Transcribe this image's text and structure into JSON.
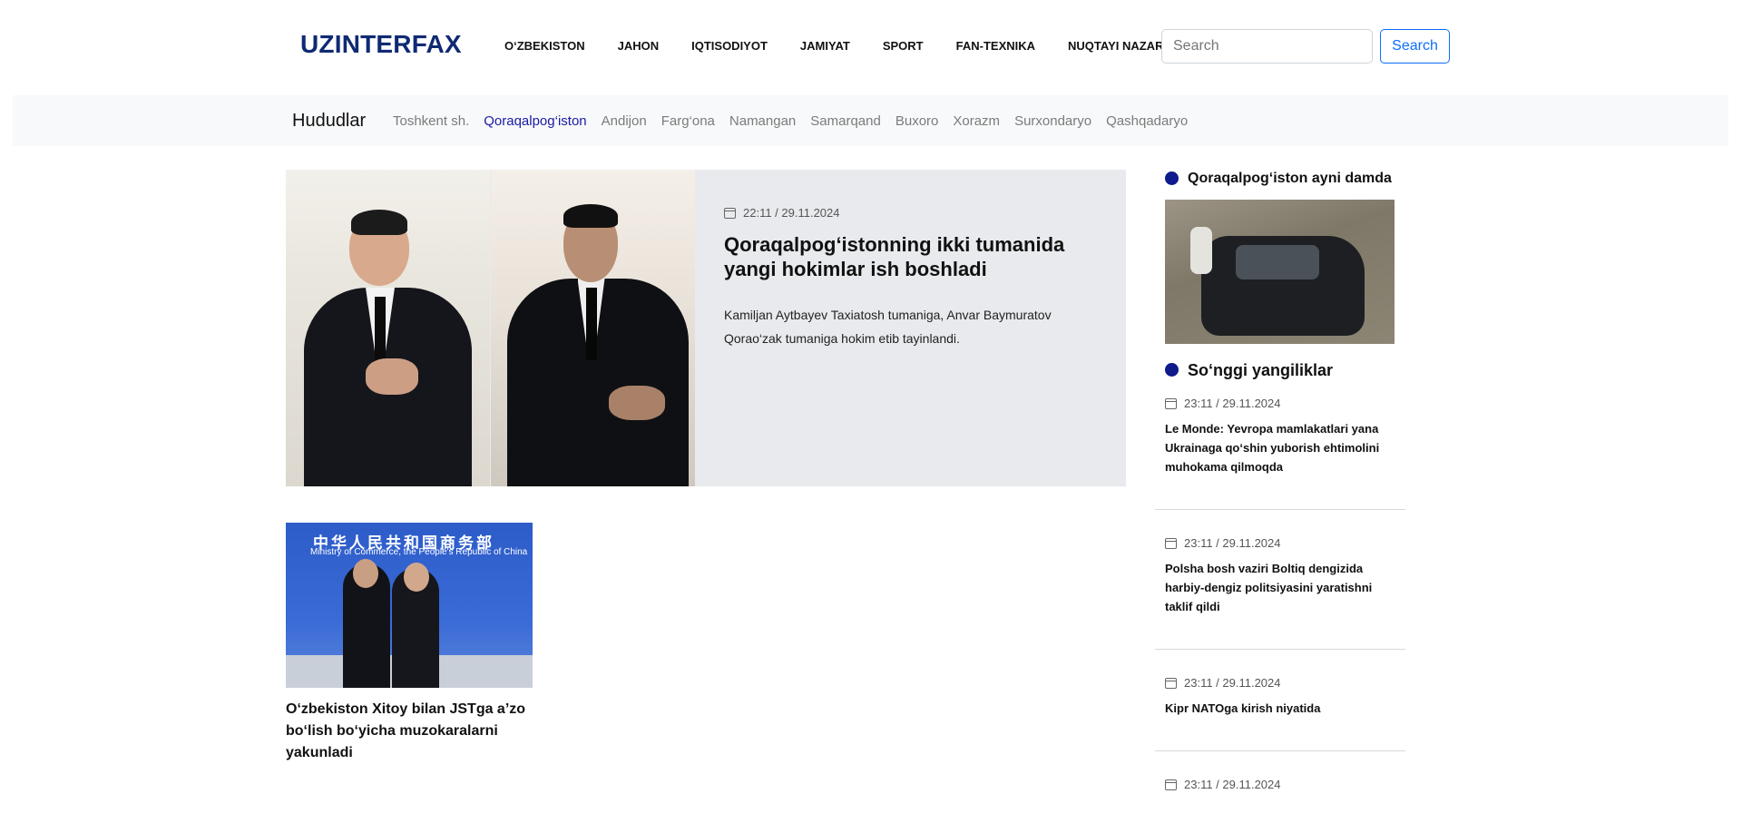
{
  "header": {
    "logo": "UZINTERFAX",
    "nav": [
      "O‘ZBEKISTON",
      "JAHON",
      "IQTISODIYOT",
      "JAMIYAT",
      "SPORT",
      "FAN-TEXNIKA",
      "NUQTAYI NAZAR"
    ],
    "search_placeholder": "Search",
    "search_button": "Search"
  },
  "regions": {
    "title": "Hududlar",
    "items": [
      "Toshkent sh.",
      "Qoraqalpog‘iston",
      "Andijon",
      "Farg‘ona",
      "Namangan",
      "Samarqand",
      "Buxoro",
      "Xorazm",
      "Surxondaryo",
      "Qashqadaryo"
    ],
    "active": "Qoraqalpog‘iston"
  },
  "hero": {
    "time": "22:11 / 29.11.2024",
    "title": "Qoraqalpog‘istonning ikki tumanida yangi hokimlar ish boshladi",
    "description": "Kamiljan Aytbayev Taxiatosh tumaniga, Anvar Baymuratov Qorao‘zak tumaniga hokim etib tayinlandi."
  },
  "article2": {
    "image_text_zh": "中华人民共和国商务部",
    "image_text_en": "Ministry of Commerce, the People's Republic of China",
    "title": "O‘zbekiston Xitoy bilan JSTga a’zo bo‘lish bo‘yicha muzokaralarni yakunladi"
  },
  "sidebar": {
    "section1_title": "Qoraqalpog‘iston ayni damda",
    "section2_title": "So‘nggi yangiliklar",
    "news": [
      {
        "time": "23:11 / 29.11.2024",
        "title": "Le Monde: Yevropa mamlakatlari yana Ukrainaga qo‘shin yuborish ehtimolini muhokama qilmoqda"
      },
      {
        "time": "23:11 / 29.11.2024",
        "title": "Polsha bosh vaziri Boltiq dengizida harbiy-dengiz politsiyasini yaratishni taklif qildi"
      },
      {
        "time": "23:11 / 29.11.2024",
        "title": "Kipr NATOga kirish niyatida"
      },
      {
        "time": "23:11 / 29.11.2024",
        "title": ""
      }
    ]
  },
  "colors": {
    "logo": "#0f2a73",
    "accent_dot": "#0f1a8c",
    "active_region": "#1a1aa6",
    "search_button": "#0d6efd"
  },
  "icons": {
    "date": "calendar-icon",
    "bullet": "circle-bullet-icon"
  }
}
